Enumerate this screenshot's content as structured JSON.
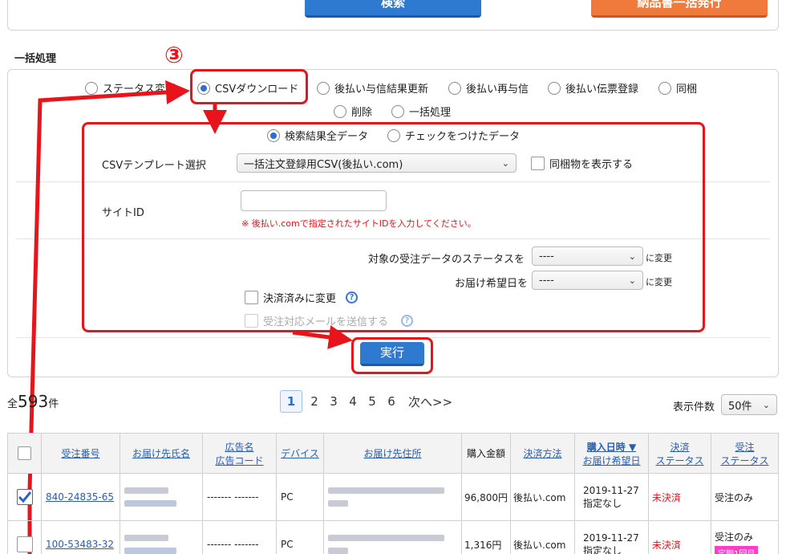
{
  "top": {
    "search_label": "検索",
    "bulk_issue_label": "納品書一括発行"
  },
  "bulk": {
    "section_title": "一括処理",
    "step_marker": "③",
    "options": [
      {
        "label": "ステータス変更",
        "selected": false
      },
      {
        "label": "CSVダウンロード",
        "selected": true
      },
      {
        "label": "後払い与信結果更新",
        "selected": false
      },
      {
        "label": "後払い再与信",
        "selected": false
      },
      {
        "label": "後払い伝票登録",
        "selected": false
      },
      {
        "label": "同梱",
        "selected": false
      },
      {
        "label": "削除",
        "selected": false
      },
      {
        "label": "一括処理",
        "selected": false
      }
    ],
    "target": {
      "all_label": "検索結果全データ",
      "checked_label": "チェックをつけたデータ",
      "selected": "all"
    },
    "template_label": "CSVテンプレート選択",
    "template_value": "一括注文登録用CSV(後払い.com)",
    "bundle_label": "同梱物を表示する",
    "site_id_label": "サイトID",
    "site_id_value": "",
    "site_id_note": "※ 後払い.comで指定されたサイトIDを入力してください。",
    "status_label": "対象の受注データのステータスを",
    "status_value": "----",
    "status_suffix": "に変更",
    "delivery_label": "お届け希望日を",
    "delivery_value": "----",
    "delivery_suffix": "に変更",
    "settled_label": "決済済みに変更",
    "mail_label": "受注対応メールを送信する",
    "execute_label": "実行"
  },
  "results": {
    "total_prefix": "全",
    "total_count": "593",
    "total_suffix": "件",
    "pages": [
      "1",
      "2",
      "3",
      "4",
      "5",
      "6"
    ],
    "current_page": "1",
    "next_label": "次へ>>",
    "per_page_label": "表示件数",
    "per_page_value": "50件"
  },
  "table": {
    "headers": {
      "order_no": "受注番号",
      "recipient": "お届け先氏名",
      "ad_name": "広告名",
      "ad_code": "広告コード",
      "device": "デバイス",
      "address": "お届け先住所",
      "amount": "購入金額",
      "payment": "決済方法",
      "purchase_date": "購入日時 ▼",
      "delivery_date": "お届け希望日",
      "settle_1": "決済",
      "settle_2": "ステータス",
      "order_1": "受注",
      "order_2": "ステータス"
    },
    "rows": [
      {
        "checked": true,
        "order_no": "840-24835-65",
        "ad": "------- -------",
        "device": "PC",
        "amount": "96,800円",
        "payment": "後払い.com",
        "date": "2019-11-27",
        "delivery": "指定なし",
        "settle": "未決済",
        "status": "受注のみ",
        "badge": ""
      },
      {
        "checked": false,
        "order_no": "100-53483-32",
        "ad": "------- -------",
        "device": "PC",
        "amount": "1,316円",
        "payment": "後払い.com",
        "date": "2019-11-27",
        "delivery": "指定なし",
        "settle": "未決済",
        "status": "受注のみ",
        "badge": "定期1回目"
      }
    ]
  },
  "colors": {
    "accent": "#2f7ad1",
    "annotation": "#e8141b",
    "unsettled": "#e0141b",
    "badge": "#ff3ec8"
  }
}
